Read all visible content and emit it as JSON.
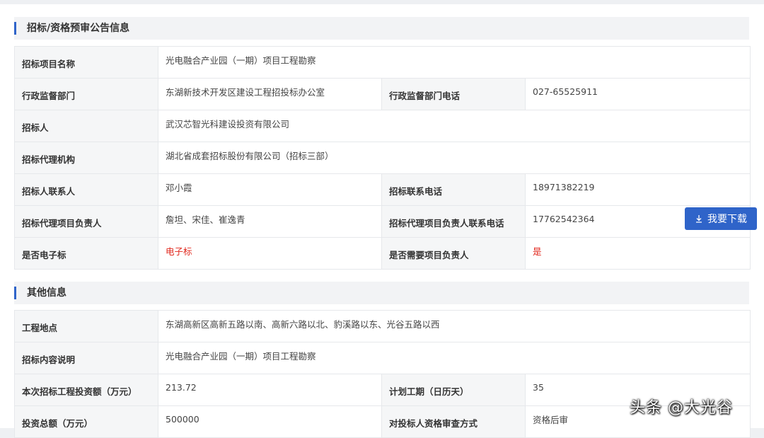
{
  "section1": {
    "title": "招标/资格预审公告信息",
    "rows": [
      {
        "k1": "招标项目名称",
        "v1": "光电融合产业园（一期）项目工程勘察"
      },
      {
        "k1": "行政监督部门",
        "v1": "东湖新技术开发区建设工程招投标办公室",
        "k2": "行政监督部门电话",
        "v2": "027-65525911"
      },
      {
        "k1": "招标人",
        "v1": "武汉芯智光科建设投资有限公司"
      },
      {
        "k1": "招标代理机构",
        "v1": "湖北省成套招标股份有限公司（招标三部）"
      },
      {
        "k1": "招标人联系人",
        "v1": "邓小霞",
        "k2": "招标联系电话",
        "v2": "18971382219"
      },
      {
        "k1": "招标代理项目负责人",
        "v1": "詹坦、宋佳、崔逸青",
        "k2": "招标代理项目负责人联系电话",
        "v2": "17762542364"
      },
      {
        "k1": "是否电子标",
        "v1": "电子标",
        "k2": "是否需要项目负责人",
        "v2": "是"
      }
    ]
  },
  "section2": {
    "title": "其他信息",
    "rows": [
      {
        "k1": "工程地点",
        "v1": "东湖高新区高新五路以南、高新六路以北、豹溪路以东、光谷五路以西"
      },
      {
        "k1": "招标内容说明",
        "v1": "光电融合产业园（一期）项目工程勘察"
      },
      {
        "k1": "本次招标工程投资额（万元）",
        "v1": "213.72",
        "k2": "计划工期（日历天）",
        "v2": "35"
      },
      {
        "k1": "投资总额（万元）",
        "v1": "500000",
        "k2": "对投标人资格审查方式",
        "v2": "资格后审"
      }
    ]
  },
  "download_button": {
    "label": "我要下载",
    "icon": "download-icon"
  },
  "watermark": "头条 @大光谷",
  "colors": {
    "accent": "#2f64c9",
    "highlight": "#e0261b"
  }
}
